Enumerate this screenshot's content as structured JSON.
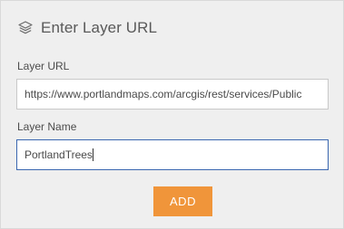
{
  "panel": {
    "title": "Enter Layer URL",
    "title_icon": "layers-icon"
  },
  "form": {
    "url_label": "Layer URL",
    "url_value": "https://www.portlandmaps.com/arcgis/rest/services/Public",
    "name_label": "Layer Name",
    "name_value": "PortlandTrees"
  },
  "actions": {
    "add_label": "ADD"
  },
  "colors": {
    "accent": "#f0953a",
    "focus_border": "#3b67b0",
    "panel_bg": "#efefef"
  }
}
